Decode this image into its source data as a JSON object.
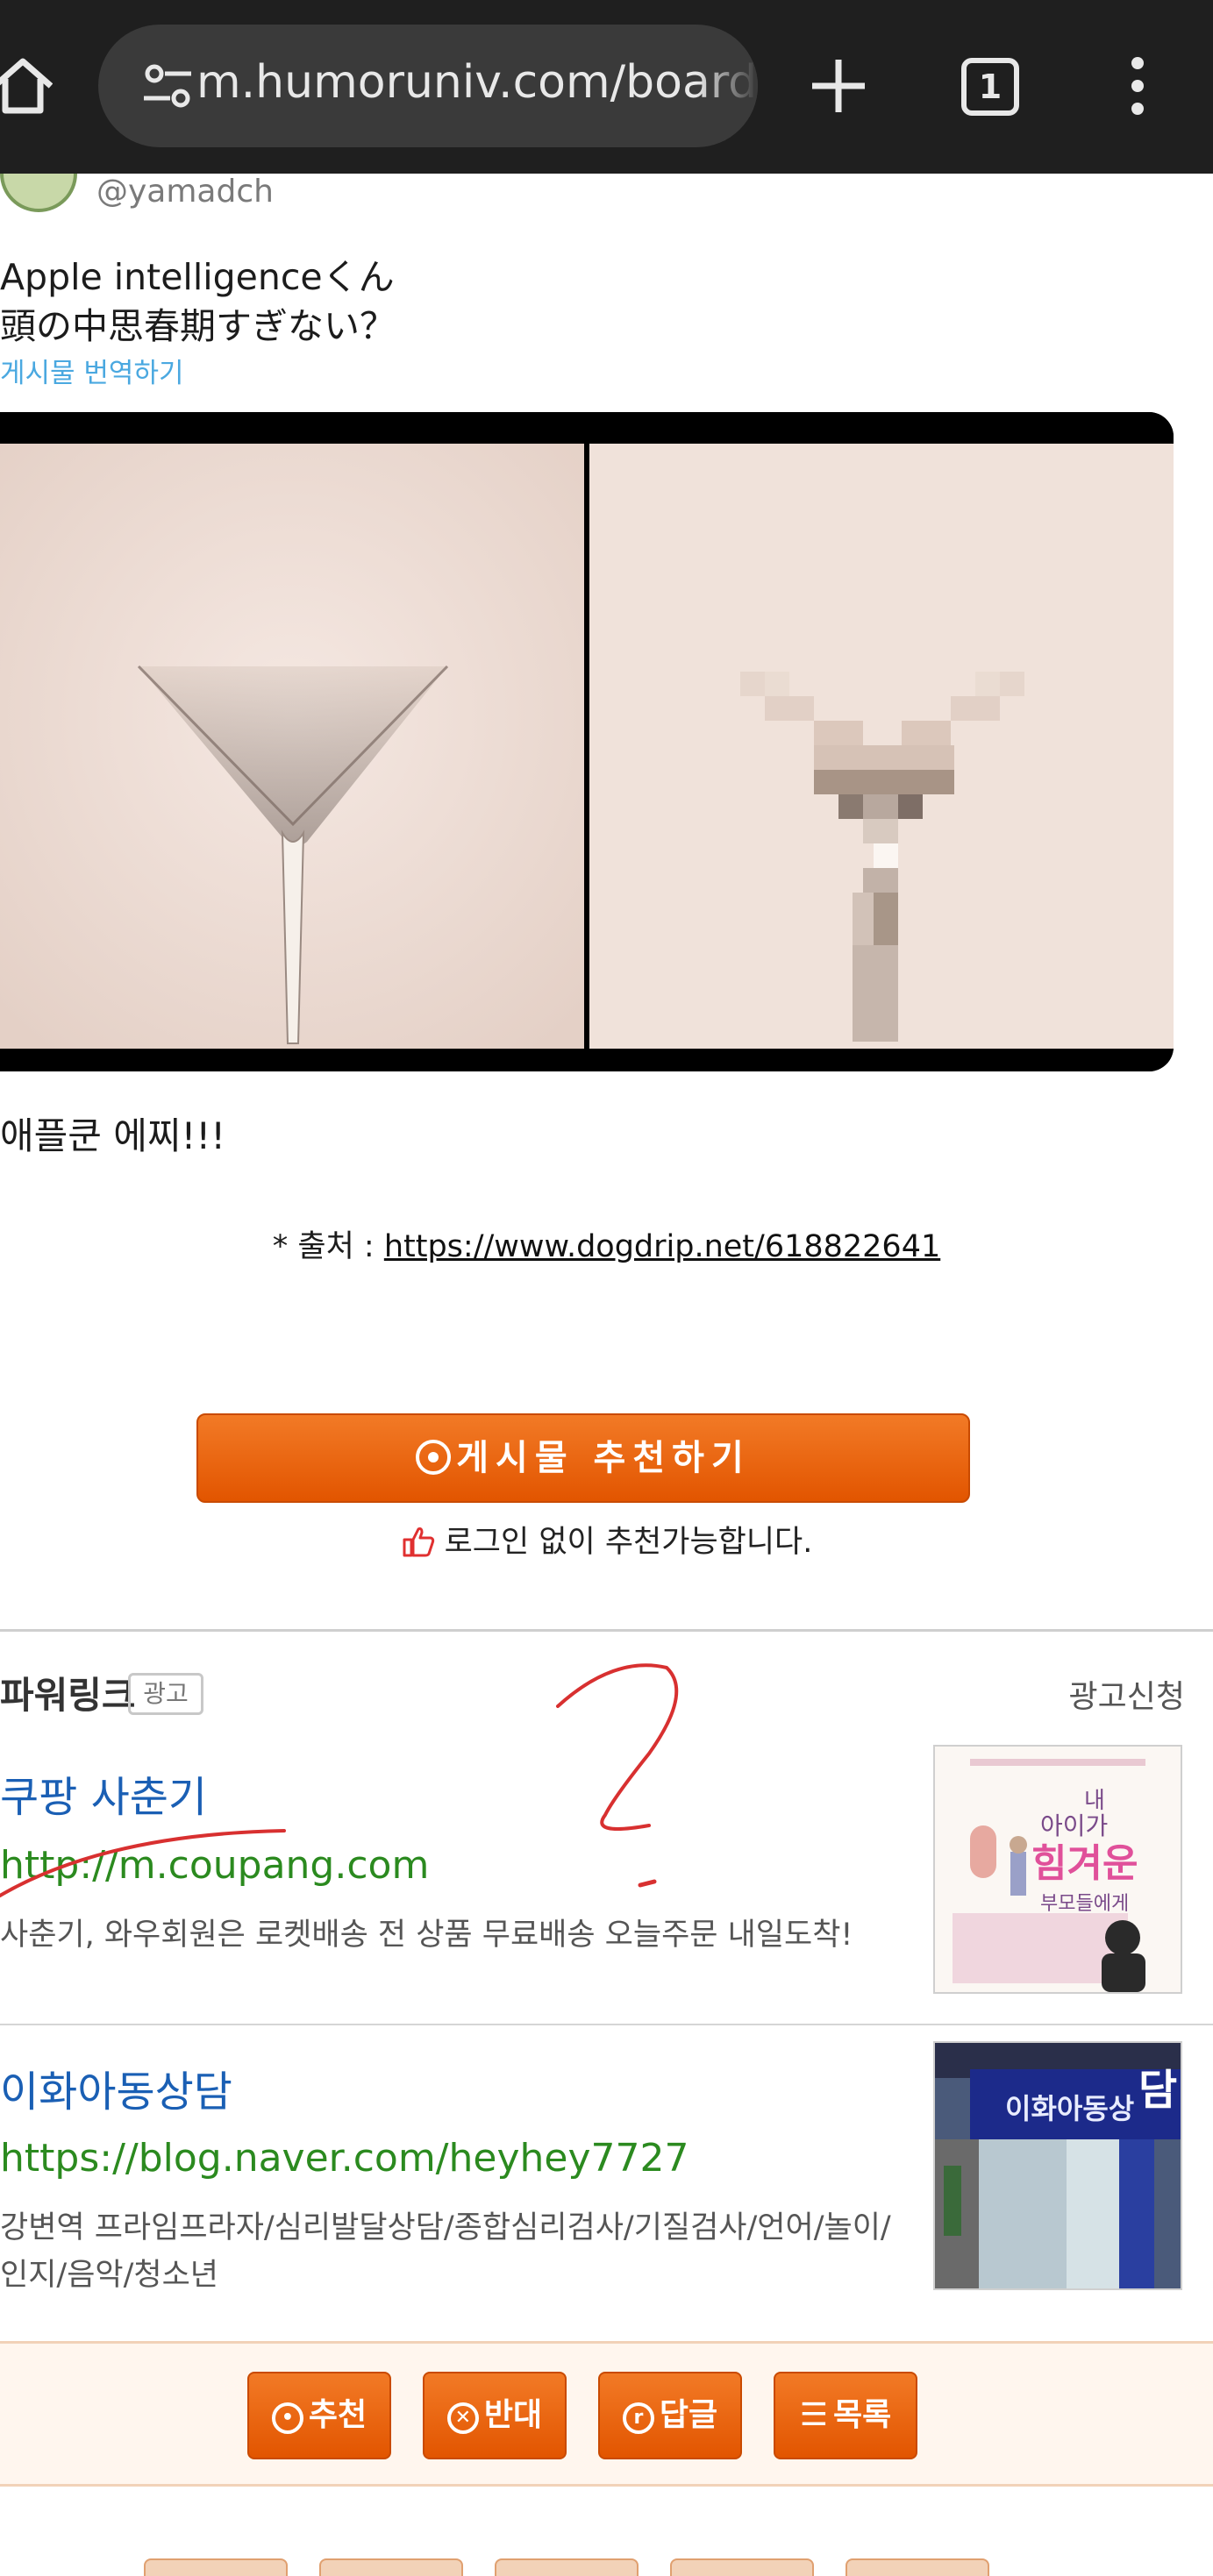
{
  "browser": {
    "url": "m.humoruniv.com/board",
    "tab_count": "1"
  },
  "tweet": {
    "handle": "@yamadch",
    "line1": "Apple intelligenceくん",
    "line2": "頭の中思春期すぎない？",
    "translate_label": "게시물 번역하기"
  },
  "post": {
    "caption": "애플쿤 에찌!!!",
    "source_prefix": "* 출처 : ",
    "source_link": "https://www.dogdrip.net/618822641",
    "recommend_button": "게시물 추천하기",
    "recommend_note": "로그인 없이 추천가능합니다."
  },
  "ads": {
    "section_title": "파워링크",
    "ad_tag": "광고",
    "apply_link": "광고신청",
    "items": [
      {
        "title": "쿠팡 사춘기",
        "url": "http://m.coupang.com",
        "desc": "사춘기, 와우회원은 로켓배송 전 상품 무료배송 오늘주문 내일도착!",
        "thumb_title": "내 아이가 힘겨운 부모들에게"
      },
      {
        "title": "이화아동상담",
        "url": "https://blog.naver.com/heyhey7727",
        "desc": "강변역 프라임프라자/심리발달상담/종합심리검사/기질검사/언어/놀이/인지/음악/청소년",
        "thumb_title": "이화아동상담"
      }
    ]
  },
  "actions": {
    "recommend": "추천",
    "oppose": "반대",
    "reply": "답글",
    "list": "목록"
  },
  "colors": {
    "accent": "#e85a06",
    "ad_title": "#1a5fb4",
    "ad_url": "#2b8a1f",
    "translate": "#4aa8e0",
    "scribble": "#d83030"
  }
}
